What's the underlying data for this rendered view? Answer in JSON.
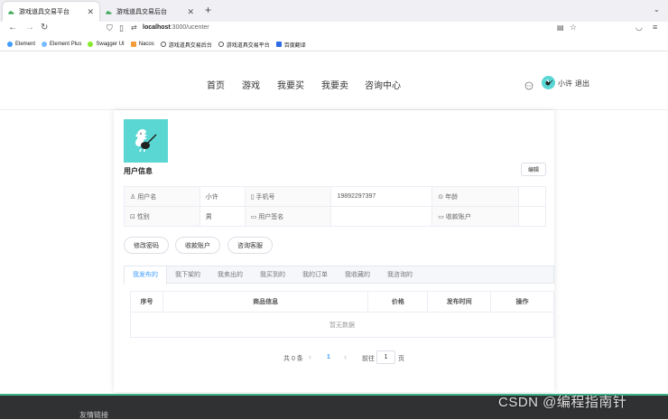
{
  "browser": {
    "tabs": [
      {
        "label": "游戏道具交易平台",
        "active": true
      },
      {
        "label": "游戏道具交易后台",
        "active": false
      }
    ],
    "new_tab": "+",
    "url_host": "localhost",
    "url_path": ":3000/ucenter",
    "bookmarks": [
      "Element",
      "Element Plus",
      "Swagger UI",
      "Nacos",
      "游戏道具交易后台",
      "游戏道具交易平台",
      "百度翻译"
    ]
  },
  "site": {
    "nav": [
      "首页",
      "游戏",
      "我要买",
      "我要卖",
      "咨询中心"
    ],
    "username": "小许",
    "logout": "退出"
  },
  "profile": {
    "title": "用户信息",
    "edit": "编辑",
    "fields": {
      "username_label": "用户名",
      "username_value": "小许",
      "phone_label": "手机号",
      "phone_value": "19892297397",
      "age_label": "年龄",
      "age_value": "",
      "gender_label": "性别",
      "gender_value": "男",
      "signature_label": "用户签名",
      "signature_value": "",
      "account_label": "收款账户",
      "account_value": ""
    },
    "actions": [
      "修改密码",
      "收款账户",
      "咨询客服"
    ]
  },
  "user_tabs": [
    "我发布的",
    "我下架的",
    "我卖出的",
    "我买到的",
    "我的订单",
    "我收藏的",
    "我咨询的"
  ],
  "table": {
    "headers": [
      "序号",
      "商品信息",
      "价格",
      "发布时间",
      "操作"
    ],
    "empty_text": "暂无数据"
  },
  "pagination": {
    "total": "共 0 条",
    "prev": "‹",
    "page": "1",
    "next": "›",
    "goto": "前往",
    "goto_value": "1",
    "page_unit": "页"
  },
  "footer": {
    "links_label": "友情链接"
  },
  "watermark": "CSDN @编程指南针",
  "colors": {
    "accent": "#409eff",
    "avatar_bg": "#5ad6d3",
    "footer_bg": "#303133",
    "footer_line": "#3db48a"
  }
}
